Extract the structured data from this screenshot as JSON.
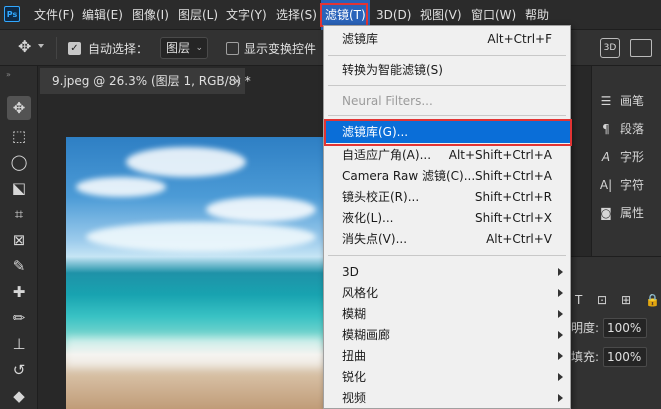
{
  "app": {
    "logo_text": "Ps"
  },
  "menubar": {
    "items": [
      "文件(F)",
      "编辑(E)",
      "图像(I)",
      "图层(L)",
      "文字(Y)",
      "选择(S)",
      "滤镜(T)",
      "3D(D)",
      "视图(V)",
      "窗口(W)",
      "帮助"
    ],
    "active_index": 6
  },
  "options_bar": {
    "move_icon": "move-tool-icon",
    "auto_select_label": "自动选择：",
    "auto_select_checked": true,
    "layer_select_value": "图层",
    "show_transform_label": "显示变换控件",
    "show_transform_checked": false
  },
  "document_tab": {
    "title": "9.jpeg @ 26.3% (图层 1, RGB/8) *",
    "close": "×"
  },
  "filter_menu": {
    "items": [
      {
        "label": "滤镜库",
        "shortcut": "Alt+Ctrl+F"
      },
      {
        "label": "转换为智能滤镜(S)",
        "shortcut": ""
      },
      {
        "label": "Neural Filters...",
        "shortcut": "",
        "disabled": true
      },
      {
        "label": "滤镜库(G)...",
        "shortcut": "",
        "highlighted": true
      },
      {
        "label": "自适应广角(A)...",
        "shortcut": "Alt+Shift+Ctrl+A"
      },
      {
        "label": "Camera Raw 滤镜(C)...",
        "shortcut": "Shift+Ctrl+A"
      },
      {
        "label": "镜头校正(R)...",
        "shortcut": "Shift+Ctrl+R"
      },
      {
        "label": "液化(L)...",
        "shortcut": "Shift+Ctrl+X"
      },
      {
        "label": "消失点(V)...",
        "shortcut": "Alt+Ctrl+V"
      },
      {
        "label": "3D",
        "submenu": true
      },
      {
        "label": "风格化",
        "submenu": true
      },
      {
        "label": "模糊",
        "submenu": true
      },
      {
        "label": "模糊画廊",
        "submenu": true
      },
      {
        "label": "扭曲",
        "submenu": true
      },
      {
        "label": "锐化",
        "submenu": true
      },
      {
        "label": "视频",
        "submenu": true
      }
    ]
  },
  "right_panels": {
    "items": [
      {
        "label": "画笔",
        "icon": "brush-settings-icon"
      },
      {
        "label": "段落",
        "icon": "paragraph-icon"
      },
      {
        "label": "字形",
        "icon": "glyph-icon"
      },
      {
        "label": "字符",
        "icon": "character-icon"
      },
      {
        "label": "属性",
        "icon": "properties-icon"
      }
    ],
    "layers": {
      "opacity_label": "明度:",
      "opacity_value": "100%",
      "fill_label": "填充:",
      "fill_value": "100%"
    }
  },
  "colors": {
    "accent": "#0a6ed8",
    "highlight_border": "#e23434",
    "menu_active": "#2a63ba"
  }
}
